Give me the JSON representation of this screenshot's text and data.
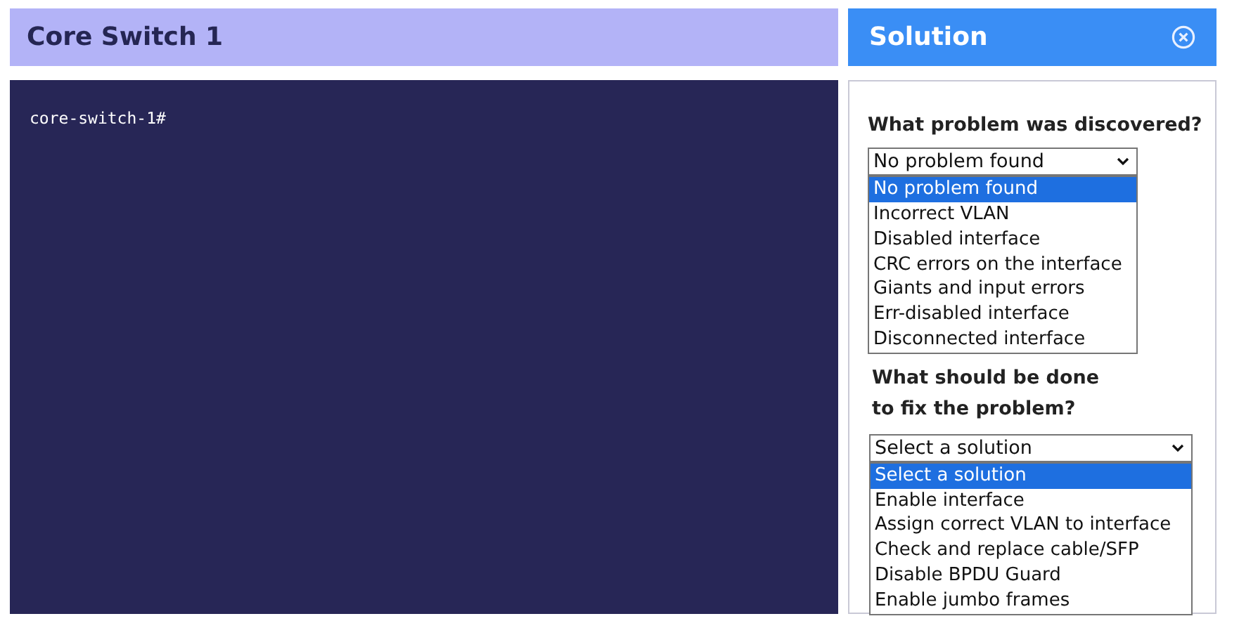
{
  "device_panel": {
    "title": "Core Switch 1",
    "terminal": {
      "prompt": "core-switch-1#"
    }
  },
  "solution_panel": {
    "title": "Solution",
    "questions": [
      {
        "label": "What problem was discovered?",
        "value": "No problem found",
        "options": [
          {
            "label": "No problem found",
            "selected": true
          },
          {
            "label": "Incorrect VLAN",
            "selected": false
          },
          {
            "label": "Disabled interface",
            "selected": false
          },
          {
            "label": "CRC errors on the interface",
            "selected": false
          },
          {
            "label": "Giants and input errors",
            "selected": false
          },
          {
            "label": "Err-disabled interface",
            "selected": false
          },
          {
            "label": "Disconnected interface",
            "selected": false
          }
        ]
      },
      {
        "label_lines": [
          "What should be done",
          "to fix the problem?"
        ],
        "value": "Select a solution",
        "options": [
          {
            "label": "Select a solution",
            "selected": true
          },
          {
            "label": "Enable interface",
            "selected": false
          },
          {
            "label": "Assign correct VLAN to interface",
            "selected": false
          },
          {
            "label": "Check and replace cable/SFP",
            "selected": false
          },
          {
            "label": "Disable BPDU Guard",
            "selected": false
          },
          {
            "label": "Enable jumbo frames",
            "selected": false
          }
        ]
      }
    ]
  }
}
